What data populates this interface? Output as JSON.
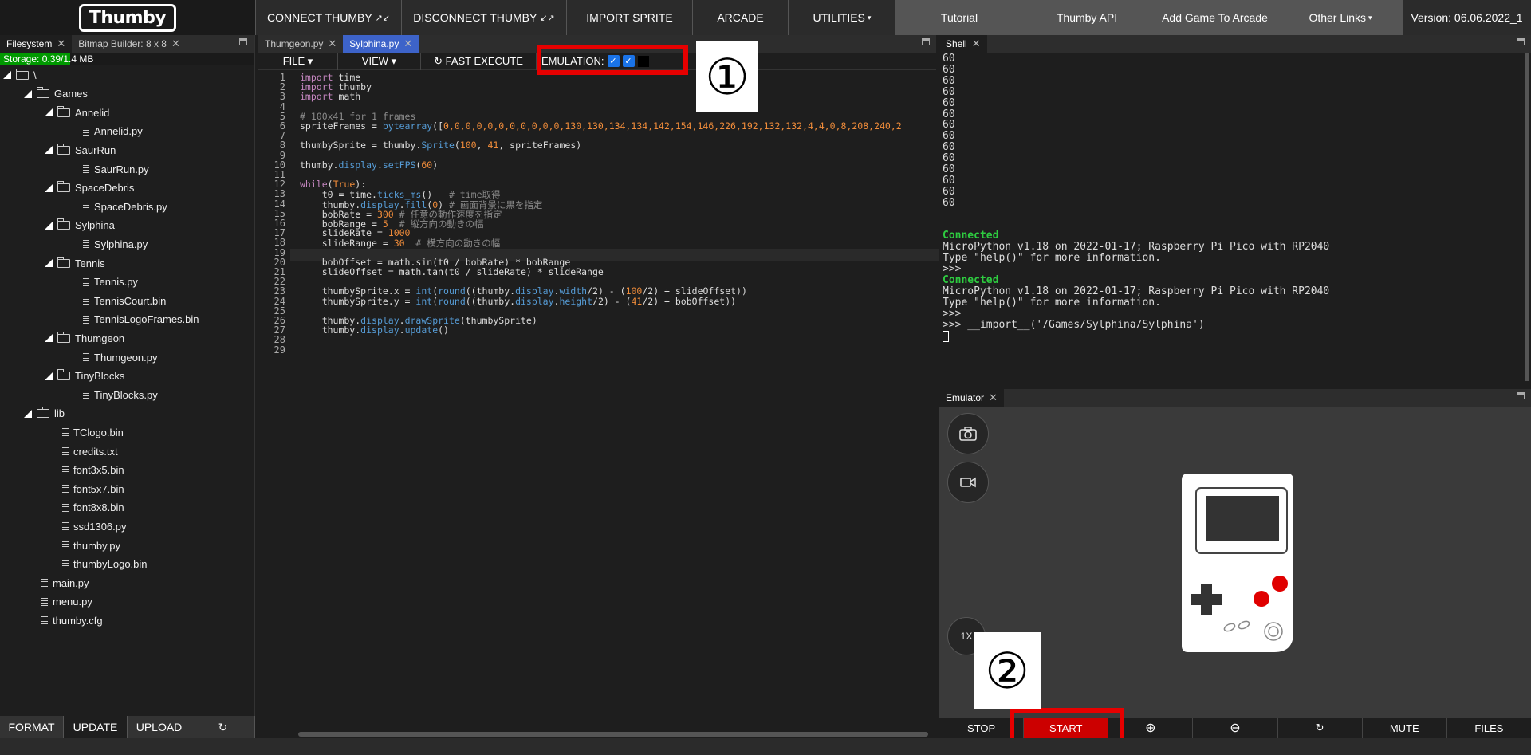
{
  "header": {
    "logo": "Thumby",
    "nav": [
      {
        "label": "CONNECT THUMBY",
        "icon": "↗↙"
      },
      {
        "label": "DISCONNECT THUMBY",
        "icon": "↙↗"
      },
      {
        "label": "IMPORT SPRITE"
      },
      {
        "label": "ARCADE"
      },
      {
        "label": "UTILITIES",
        "caret": "▾"
      }
    ],
    "links": [
      {
        "label": "Tutorial"
      },
      {
        "label": "Thumby API"
      },
      {
        "label": "Add Game To Arcade"
      },
      {
        "label": "Other Links",
        "caret": "▾"
      },
      {
        "label": "Version: 06.06.2022_1"
      }
    ]
  },
  "filesystem": {
    "tabs": [
      "Filesystem",
      "Bitmap Builder: 8 x 8"
    ],
    "storage": "Storage: 0.39/1.4 MB",
    "storage_fraction": 0.28,
    "tree": [
      {
        "name": "\\",
        "type": "folder",
        "depth": 0
      },
      {
        "name": "Games",
        "type": "folder",
        "depth": 1
      },
      {
        "name": "Annelid",
        "type": "folder",
        "depth": 2
      },
      {
        "name": "Annelid.py",
        "type": "file",
        "depth": 3
      },
      {
        "name": "SaurRun",
        "type": "folder",
        "depth": 2
      },
      {
        "name": "SaurRun.py",
        "type": "file",
        "depth": 3
      },
      {
        "name": "SpaceDebris",
        "type": "folder",
        "depth": 2
      },
      {
        "name": "SpaceDebris.py",
        "type": "file",
        "depth": 3
      },
      {
        "name": "Sylphina",
        "type": "folder",
        "depth": 2
      },
      {
        "name": "Sylphina.py",
        "type": "file",
        "depth": 3
      },
      {
        "name": "Tennis",
        "type": "folder",
        "depth": 2
      },
      {
        "name": "Tennis.py",
        "type": "file",
        "depth": 3
      },
      {
        "name": "TennisCourt.bin",
        "type": "file",
        "depth": 3
      },
      {
        "name": "TennisLogoFrames.bin",
        "type": "file",
        "depth": 3
      },
      {
        "name": "Thumgeon",
        "type": "folder",
        "depth": 2
      },
      {
        "name": "Thumgeon.py",
        "type": "file",
        "depth": 3
      },
      {
        "name": "TinyBlocks",
        "type": "folder",
        "depth": 2
      },
      {
        "name": "TinyBlocks.py",
        "type": "file",
        "depth": 3
      },
      {
        "name": "lib",
        "type": "folder",
        "depth": 1
      },
      {
        "name": "TClogo.bin",
        "type": "file",
        "depth": 2
      },
      {
        "name": "credits.txt",
        "type": "file",
        "depth": 2
      },
      {
        "name": "font3x5.bin",
        "type": "file",
        "depth": 2
      },
      {
        "name": "font5x7.bin",
        "type": "file",
        "depth": 2
      },
      {
        "name": "font8x8.bin",
        "type": "file",
        "depth": 2
      },
      {
        "name": "ssd1306.py",
        "type": "file",
        "depth": 2
      },
      {
        "name": "thumby.py",
        "type": "file",
        "depth": 2
      },
      {
        "name": "thumbyLogo.bin",
        "type": "file",
        "depth": 2
      },
      {
        "name": "main.py",
        "type": "file",
        "depth": 1
      },
      {
        "name": "menu.py",
        "type": "file",
        "depth": 1
      },
      {
        "name": "thumby.cfg",
        "type": "file",
        "depth": 1
      }
    ],
    "buttons": [
      "FORMAT",
      "UPDATE",
      "UPLOAD",
      "↻"
    ]
  },
  "editor": {
    "tabs": [
      "Thumgeon.py",
      "Sylphina.py"
    ],
    "toolbar": {
      "file": "FILE ▾",
      "view": "VIEW ▾",
      "fast_execute": "↻ FAST EXECUTE",
      "emulation": "EMULATION:"
    },
    "lines": [
      [
        [
          "kw",
          "import"
        ],
        [
          "t",
          " time"
        ]
      ],
      [
        [
          "kw",
          "import"
        ],
        [
          "t",
          " thumby"
        ]
      ],
      [
        [
          "kw",
          "import"
        ],
        [
          "t",
          " math"
        ]
      ],
      [],
      [
        [
          "cm",
          "# 100x41 for 1 frames"
        ]
      ],
      [
        [
          "t",
          "spriteFrames = "
        ],
        [
          "fn",
          "bytearray"
        ],
        [
          "t",
          "(["
        ],
        [
          "num",
          "0,0,0,0,0,0,0,0,0,0,0,130,130,134,134,142,154,146,226,192,132,132,4,4,0,8,208,240,2"
        ]
      ],
      [],
      [
        [
          "t",
          "thumbySprite = thumby."
        ],
        [
          "fn",
          "Sprite"
        ],
        [
          "t",
          "("
        ],
        [
          "num",
          "100"
        ],
        [
          "t",
          ", "
        ],
        [
          "num",
          "41"
        ],
        [
          "t",
          ", spriteFrames)"
        ]
      ],
      [],
      [
        [
          "t",
          "thumby."
        ],
        [
          "fn",
          "display"
        ],
        [
          "t",
          "."
        ],
        [
          "fn",
          "setFPS"
        ],
        [
          "t",
          "("
        ],
        [
          "num",
          "60"
        ],
        [
          "t",
          ")"
        ]
      ],
      [],
      [
        [
          "kw",
          "while"
        ],
        [
          "t",
          "("
        ],
        [
          "num",
          "True"
        ],
        [
          "t",
          "):"
        ]
      ],
      [
        [
          "t",
          "    t0 = time."
        ],
        [
          "fn",
          "ticks_ms"
        ],
        [
          "t",
          "()   "
        ],
        [
          "cm",
          "# time取得"
        ]
      ],
      [
        [
          "t",
          "    thumby."
        ],
        [
          "fn",
          "display"
        ],
        [
          "t",
          "."
        ],
        [
          "fn",
          "fill"
        ],
        [
          "t",
          "("
        ],
        [
          "num",
          "0"
        ],
        [
          "t",
          ") "
        ],
        [
          "cm",
          "# 画面背景に黒を指定"
        ]
      ],
      [
        [
          "t",
          "    bobRate = "
        ],
        [
          "num",
          "300"
        ],
        [
          "t",
          " "
        ],
        [
          "cm",
          "# 任意の動作速度を指定"
        ]
      ],
      [
        [
          "t",
          "    bobRange = "
        ],
        [
          "num",
          "5"
        ],
        [
          "t",
          "  "
        ],
        [
          "cm",
          "# 縦方向の動きの幅"
        ]
      ],
      [
        [
          "t",
          "    slideRate = "
        ],
        [
          "num",
          "1000"
        ]
      ],
      [
        [
          "t",
          "    slideRange = "
        ],
        [
          "num",
          "30"
        ],
        [
          "t",
          "  "
        ],
        [
          "cm",
          "# 横方向の動きの幅"
        ]
      ],
      [],
      [
        [
          "t",
          "    bobOffset = math.sin(t0 / bobRate) * bobRange"
        ]
      ],
      [
        [
          "t",
          "    slideOffset = math.tan(t0 / slideRate) * slideRange"
        ]
      ],
      [],
      [
        [
          "t",
          "    thumbySprite.x = "
        ],
        [
          "fn",
          "int"
        ],
        [
          "t",
          "("
        ],
        [
          "fn",
          "round"
        ],
        [
          "t",
          "((thumby."
        ],
        [
          "fn",
          "display"
        ],
        [
          "t",
          "."
        ],
        [
          "fn",
          "width"
        ],
        [
          "t",
          "/2) - ("
        ],
        [
          "num",
          "100"
        ],
        [
          "t",
          "/2) + slideOffset))"
        ]
      ],
      [
        [
          "t",
          "    thumbySprite.y = "
        ],
        [
          "fn",
          "int"
        ],
        [
          "t",
          "("
        ],
        [
          "fn",
          "round"
        ],
        [
          "t",
          "((thumby."
        ],
        [
          "fn",
          "display"
        ],
        [
          "t",
          "."
        ],
        [
          "fn",
          "height"
        ],
        [
          "t",
          "/2) - ("
        ],
        [
          "num",
          "41"
        ],
        [
          "t",
          "/2) + bobOffset))"
        ]
      ],
      [],
      [
        [
          "t",
          "    thumby."
        ],
        [
          "fn",
          "display"
        ],
        [
          "t",
          "."
        ],
        [
          "fn",
          "drawSprite"
        ],
        [
          "t",
          "(thumbySprite)"
        ]
      ],
      [
        [
          "t",
          "    thumby."
        ],
        [
          "fn",
          "display"
        ],
        [
          "t",
          "."
        ],
        [
          "fn",
          "update"
        ],
        [
          "t",
          "()"
        ]
      ],
      [],
      []
    ]
  },
  "shell": {
    "tab": "Shell",
    "lines": [
      [
        "t",
        "60"
      ],
      [
        "t",
        "60"
      ],
      [
        "t",
        "60"
      ],
      [
        "t",
        "60"
      ],
      [
        "t",
        "60"
      ],
      [
        "t",
        "60"
      ],
      [
        "t",
        "60"
      ],
      [
        "t",
        "60"
      ],
      [
        "t",
        "60"
      ],
      [
        "t",
        "60"
      ],
      [
        "t",
        "60"
      ],
      [
        "t",
        "60"
      ],
      [
        "t",
        "60"
      ],
      [
        "t",
        "60"
      ],
      [
        "t",
        ""
      ],
      [
        "t",
        ""
      ],
      [
        "g",
        "Connected"
      ],
      [
        "t",
        "MicroPython v1.18 on 2022-01-17; Raspberry Pi Pico with RP2040"
      ],
      [
        "t",
        "Type \"help()\" for more information."
      ],
      [
        "t",
        ">>>"
      ],
      [
        "g",
        "Connected"
      ],
      [
        "t",
        "MicroPython v1.18 on 2022-01-17; Raspberry Pi Pico with RP2040"
      ],
      [
        "t",
        "Type \"help()\" for more information."
      ],
      [
        "t",
        ">>>"
      ],
      [
        "t",
        ">>> __import__('/Games/Sylphina/Sylphina')"
      ]
    ]
  },
  "emulator": {
    "tab": "Emulator",
    "zoom": "1X",
    "buttons": [
      "STOP",
      "START",
      "⊕",
      "⊖",
      "↻",
      "MUTE",
      "FILES"
    ]
  },
  "annotations": [
    "①",
    "②"
  ],
  "colors": {
    "accent_red": "#e60000",
    "start_red": "#cc0000",
    "connected_green": "#2ecc40",
    "tab_blue": "#3d63c9"
  }
}
